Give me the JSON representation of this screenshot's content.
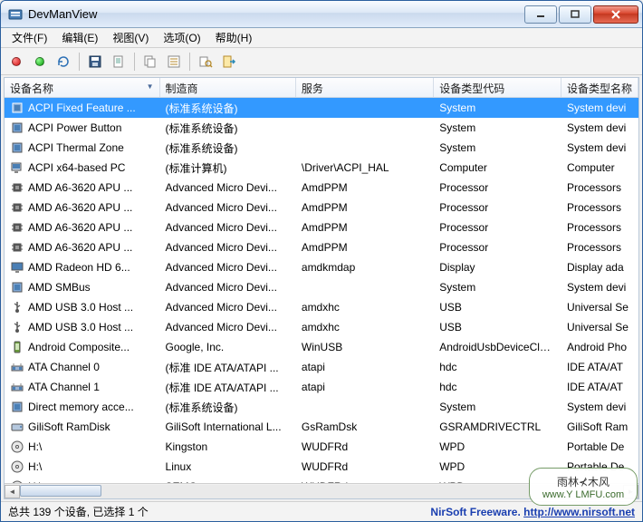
{
  "window": {
    "title": "DevManView"
  },
  "menu": {
    "file": "文件(F)",
    "edit": "编辑(E)",
    "view": "视图(V)",
    "options": "选项(O)",
    "help": "帮助(H)"
  },
  "toolbar": {
    "disable": "disable-device",
    "enable": "enable-device",
    "refresh": "refresh",
    "save": "save",
    "open": "open",
    "copy": "copy",
    "properties": "properties",
    "find": "find",
    "exit": "exit"
  },
  "columns": {
    "name": "设备名称",
    "vendor": "制造商",
    "service": "服务",
    "typecode": "设备类型代码",
    "typename": "设备类型名称"
  },
  "rows": [
    {
      "icon": "chip",
      "name": "ACPI Fixed Feature ...",
      "vendor": "(标准系统设备)",
      "service": "",
      "typecode": "System",
      "typename": "System devi",
      "selected": true
    },
    {
      "icon": "chip",
      "name": "ACPI Power Button",
      "vendor": "(标准系统设备)",
      "service": "",
      "typecode": "System",
      "typename": "System devi"
    },
    {
      "icon": "chip",
      "name": "ACPI Thermal Zone",
      "vendor": "(标准系统设备)",
      "service": "",
      "typecode": "System",
      "typename": "System devi"
    },
    {
      "icon": "pc",
      "name": "ACPI x64-based PC",
      "vendor": "(标准计算机)",
      "service": "\\Driver\\ACPI_HAL",
      "typecode": "Computer",
      "typename": "Computer"
    },
    {
      "icon": "cpu",
      "name": "AMD A6-3620 APU ...",
      "vendor": "Advanced Micro Devi...",
      "service": "AmdPPM",
      "typecode": "Processor",
      "typename": "Processors"
    },
    {
      "icon": "cpu",
      "name": "AMD A6-3620 APU ...",
      "vendor": "Advanced Micro Devi...",
      "service": "AmdPPM",
      "typecode": "Processor",
      "typename": "Processors"
    },
    {
      "icon": "cpu",
      "name": "AMD A6-3620 APU ...",
      "vendor": "Advanced Micro Devi...",
      "service": "AmdPPM",
      "typecode": "Processor",
      "typename": "Processors"
    },
    {
      "icon": "cpu",
      "name": "AMD A6-3620 APU ...",
      "vendor": "Advanced Micro Devi...",
      "service": "AmdPPM",
      "typecode": "Processor",
      "typename": "Processors"
    },
    {
      "icon": "display",
      "name": "AMD Radeon HD 6...",
      "vendor": "Advanced Micro Devi...",
      "service": "amdkmdap",
      "typecode": "Display",
      "typename": "Display ada"
    },
    {
      "icon": "chip",
      "name": "AMD SMBus",
      "vendor": "Advanced Micro Devi...",
      "service": "",
      "typecode": "System",
      "typename": "System devi"
    },
    {
      "icon": "usb",
      "name": "AMD USB 3.0 Host ...",
      "vendor": "Advanced Micro Devi...",
      "service": "amdxhc",
      "typecode": "USB",
      "typename": "Universal Se"
    },
    {
      "icon": "usb",
      "name": "AMD USB 3.0 Host ...",
      "vendor": "Advanced Micro Devi...",
      "service": "amdxhc",
      "typecode": "USB",
      "typename": "Universal Se"
    },
    {
      "icon": "phone",
      "name": "Android Composite...",
      "vendor": "Google, Inc.",
      "service": "WinUSB",
      "typecode": "AndroidUsbDeviceClass",
      "typename": "Android Pho"
    },
    {
      "icon": "ide",
      "name": "ATA Channel 0",
      "vendor": "(标准 IDE ATA/ATAPI ...",
      "service": "atapi",
      "typecode": "hdc",
      "typename": "IDE ATA/AT"
    },
    {
      "icon": "ide",
      "name": "ATA Channel 1",
      "vendor": "(标准 IDE ATA/ATAPI ...",
      "service": "atapi",
      "typecode": "hdc",
      "typename": "IDE ATA/AT"
    },
    {
      "icon": "chip",
      "name": "Direct memory acce...",
      "vendor": "(标准系统设备)",
      "service": "",
      "typecode": "System",
      "typename": "System devi"
    },
    {
      "icon": "disk",
      "name": "GiliSoft RamDisk",
      "vendor": "GiliSoft International L...",
      "service": "GsRamDsk",
      "typecode": "GSRAMDRIVECTRL",
      "typename": "GiliSoft Ram"
    },
    {
      "icon": "disc",
      "name": "H:\\",
      "vendor": "Kingston",
      "service": "WUDFRd",
      "typecode": "WPD",
      "typename": "Portable De"
    },
    {
      "icon": "disc",
      "name": "H:\\",
      "vendor": "Linux",
      "service": "WUDFRd",
      "typecode": "WPD",
      "typename": "Portable De"
    },
    {
      "icon": "disc",
      "name": "H:\\",
      "vendor": "SEMC",
      "service": "WUDFRd",
      "typecode": "WPD",
      "typename": ""
    }
  ],
  "status": {
    "left": "总共 139 个设备, 已选择 1 个",
    "right_prefix": "NirSoft Freeware.  ",
    "right_link": "http://www.nirsoft.net"
  },
  "watermark": {
    "cn": "雨林⊀木风",
    "en": "www.Y LMFU.com"
  }
}
